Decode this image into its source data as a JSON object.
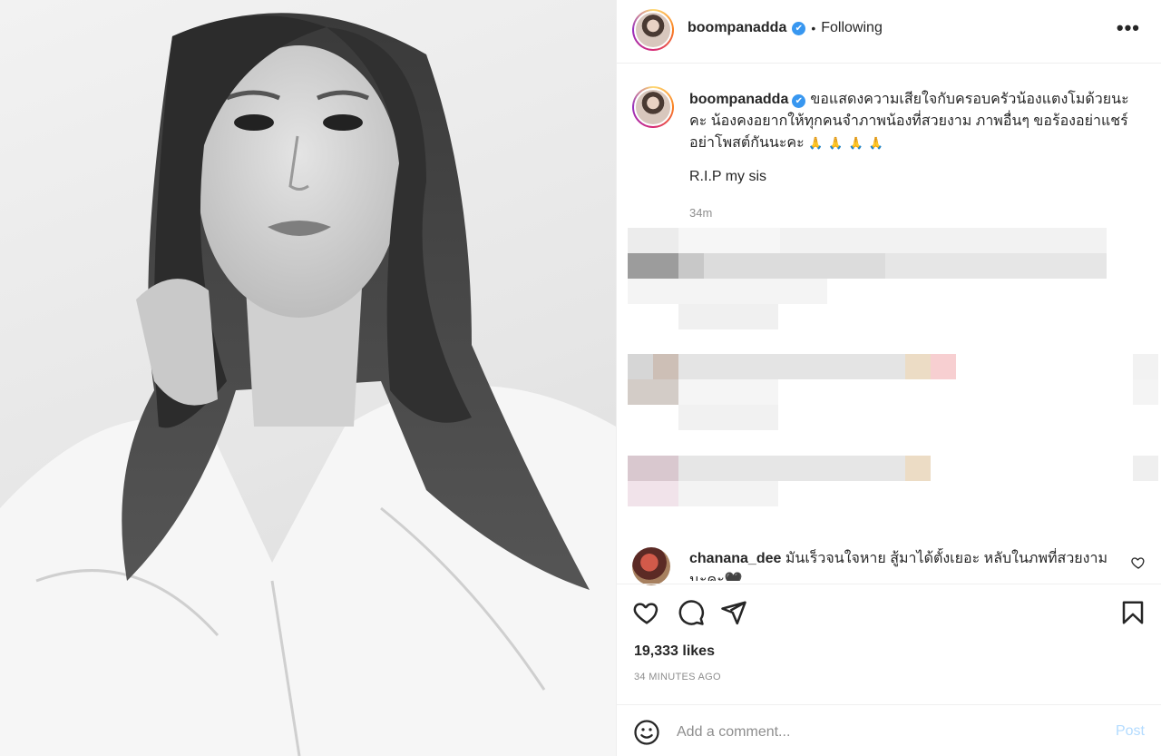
{
  "post": {
    "username": "boompanadda",
    "follow_status": "Following",
    "separator": "•",
    "more_label": "•••",
    "verified_mark": "✔"
  },
  "caption": {
    "username": "boompanadda",
    "text": "ขอแสดงความเสียใจกับครอบครัวน้องแตงโมด้วยนะคะ น้องคงอยากให้ทุกคนจำภาพน้องที่สวยงาม ภาพอื่นๆ ขอร้องอย่าแชร์ อย่าโพสต์กันนะคะ",
    "emoji": "🙏🙏🙏🙏",
    "rip": "R.I.P my sis",
    "time_ago": "34m"
  },
  "comment": {
    "username": "chanana_dee",
    "text": "มันเร็วจนใจหาย สู้มาได้ตั้งเยอะ หลับในภพที่สวยงามนะคะ🖤"
  },
  "stats": {
    "likes": "19,333 likes",
    "posted": "34 MINUTES AGO"
  },
  "add_comment": {
    "placeholder": "Add a comment...",
    "post_label": "Post"
  },
  "colors": {
    "verified": "#3897f0",
    "post_disabled": "#b3dbff",
    "muted": "#8e8e8e"
  }
}
